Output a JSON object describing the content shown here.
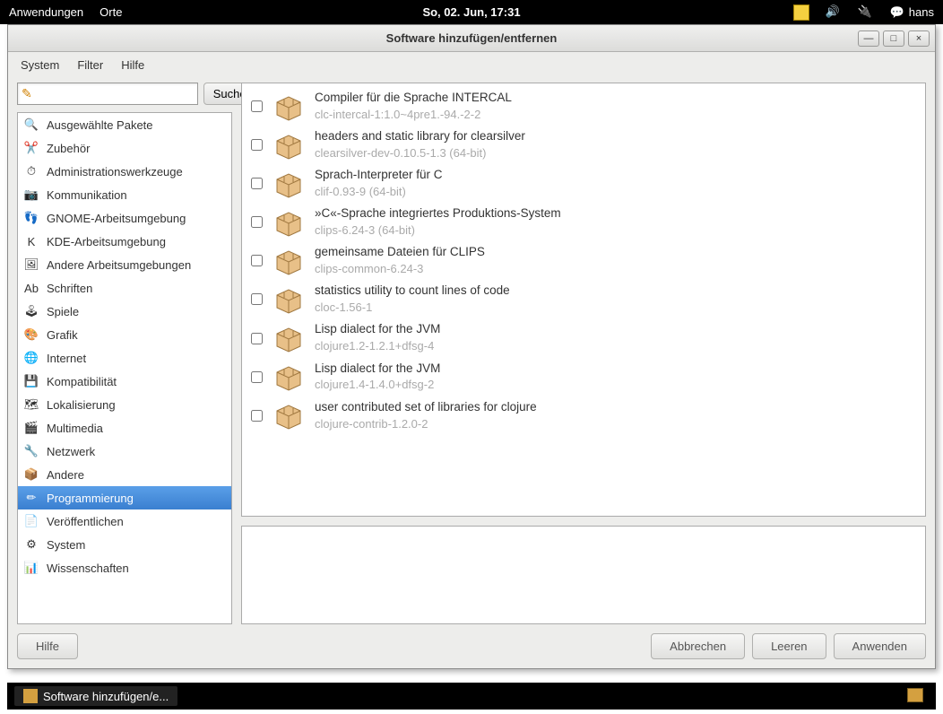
{
  "top_panel": {
    "apps": "Anwendungen",
    "places": "Orte",
    "clock": "So, 02. Jun, 17:31",
    "user": "hans"
  },
  "window": {
    "title": "Software hinzufügen/entfernen",
    "controls": {
      "min": "—",
      "max": "□",
      "close": "×"
    }
  },
  "menubar": {
    "system": "System",
    "filter": "Filter",
    "help": "Hilfe"
  },
  "search": {
    "value": "",
    "button": "Suchen",
    "icon": "✎"
  },
  "categories": [
    {
      "label": "Ausgewählte Pakete",
      "icon": "🔍",
      "selected": false
    },
    {
      "label": "Zubehör",
      "icon": "✂️",
      "selected": false
    },
    {
      "label": "Administrationswerkzeuge",
      "icon": "⏱",
      "selected": false
    },
    {
      "label": "Kommunikation",
      "icon": "📷",
      "selected": false
    },
    {
      "label": "GNOME-Arbeitsumgebung",
      "icon": "👣",
      "selected": false
    },
    {
      "label": "KDE-Arbeitsumgebung",
      "icon": "K",
      "selected": false
    },
    {
      "label": "Andere Arbeitsumgebungen",
      "icon": "🖼",
      "selected": false
    },
    {
      "label": "Schriften",
      "icon": "Ab",
      "selected": false
    },
    {
      "label": "Spiele",
      "icon": "🕹",
      "selected": false
    },
    {
      "label": "Grafik",
      "icon": "🎨",
      "selected": false
    },
    {
      "label": "Internet",
      "icon": "🌐",
      "selected": false
    },
    {
      "label": "Kompatibilität",
      "icon": "💾",
      "selected": false
    },
    {
      "label": "Lokalisierung",
      "icon": "🗺",
      "selected": false
    },
    {
      "label": "Multimedia",
      "icon": "🎬",
      "selected": false
    },
    {
      "label": "Netzwerk",
      "icon": "🔧",
      "selected": false
    },
    {
      "label": "Andere",
      "icon": "📦",
      "selected": false
    },
    {
      "label": "Programmierung",
      "icon": "✏",
      "selected": true
    },
    {
      "label": "Veröffentlichen",
      "icon": "📄",
      "selected": false
    },
    {
      "label": "System",
      "icon": "⚙",
      "selected": false
    },
    {
      "label": "Wissenschaften",
      "icon": "📊",
      "selected": false
    }
  ],
  "packages": [
    {
      "title": "Compiler für die Sprache INTERCAL",
      "version": "clc-intercal-1:1.0~4pre1.-94.-2-2"
    },
    {
      "title": "headers and static library for clearsilver",
      "version": "clearsilver-dev-0.10.5-1.3 (64-bit)"
    },
    {
      "title": "Sprach-Interpreter für C",
      "version": "clif-0.93-9 (64-bit)"
    },
    {
      "title": "»C«-Sprache integriertes Produktions-System",
      "version": "clips-6.24-3 (64-bit)"
    },
    {
      "title": "gemeinsame Dateien für CLIPS",
      "version": "clips-common-6.24-3"
    },
    {
      "title": "statistics utility to count lines of code",
      "version": "cloc-1.56-1"
    },
    {
      "title": "Lisp dialect for the JVM",
      "version": "clojure1.2-1.2.1+dfsg-4"
    },
    {
      "title": "Lisp dialect for the JVM",
      "version": "clojure1.4-1.4.0+dfsg-2"
    },
    {
      "title": "user contributed set of libraries for clojure",
      "version": "clojure-contrib-1.2.0-2"
    }
  ],
  "footer": {
    "help": "Hilfe",
    "cancel": "Abbrechen",
    "clear": "Leeren",
    "apply": "Anwenden"
  },
  "taskbar": {
    "item": "Software hinzufügen/e..."
  }
}
